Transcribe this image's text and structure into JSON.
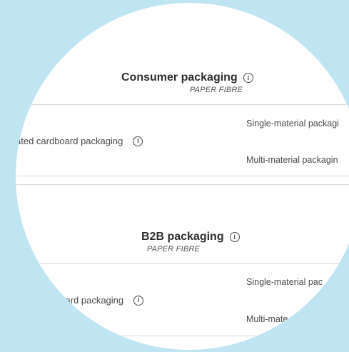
{
  "sections": [
    {
      "title": "Consumer packaging",
      "subtitle": "PAPER FIBRE",
      "row_label": "ated cardboard packaging",
      "options": [
        "Single-material packagi",
        "Multi-material packagin"
      ]
    },
    {
      "title": "B2B packaging",
      "subtitle": "PAPER FIBRE",
      "row_label": "board packaging",
      "options": [
        "Single-material pac",
        "Multi-mate"
      ]
    }
  ],
  "icons": {
    "info": "info-icon"
  },
  "colors": {
    "background": "#bfe5f3",
    "panel": "#ffffff",
    "divider": "#d9d9d9",
    "text": "#3d3d3d"
  }
}
